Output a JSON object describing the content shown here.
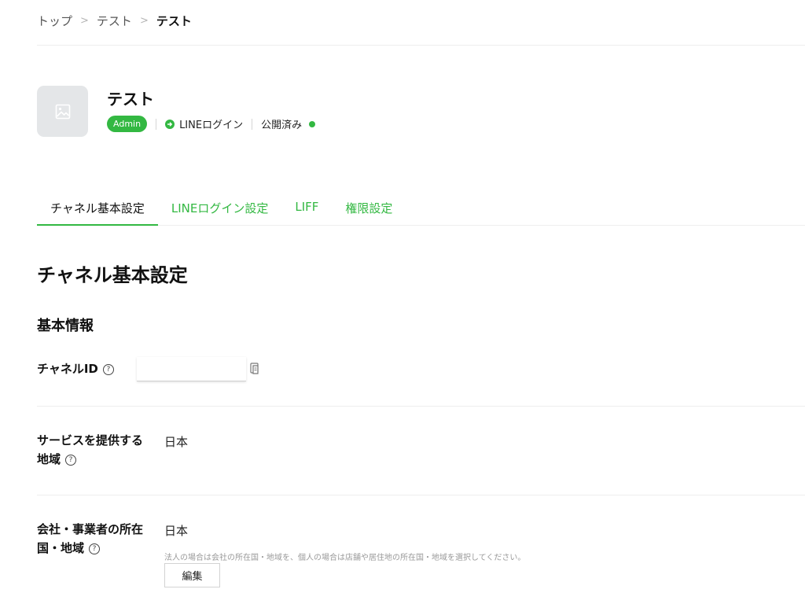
{
  "breadcrumb": {
    "items": [
      "トップ",
      "テスト",
      "テスト"
    ],
    "separator": ">"
  },
  "channel": {
    "title": "テスト",
    "role_badge": "Admin",
    "type_label": "LINEログイン",
    "status": "公開済み",
    "status_color": "#33b842",
    "thumbnail_icon": "image-icon"
  },
  "tabs": [
    {
      "label": "チャネル基本設定",
      "active": true
    },
    {
      "label": "LINEログイン設定",
      "active": false
    },
    {
      "label": "LIFF",
      "active": false
    },
    {
      "label": "権限設定",
      "active": false
    }
  ],
  "main": {
    "page_heading": "チャネル基本設定",
    "section_heading": "基本情報",
    "channel_id": {
      "label": "チャネルID",
      "help": "?",
      "value": "",
      "copy_icon": "copy-icon"
    },
    "service_region": {
      "label_line1": "サービスを提供する",
      "label_line2": "地域",
      "help": "?",
      "value": "日本"
    },
    "company_region": {
      "label_line1": "会社・事業者の所在",
      "label_line2": "国・地域",
      "help": "?",
      "value": "日本",
      "note": "法人の場合は会社の所在国・地域を、個人の場合は店舗や居住地の所在国・地域を選択してください。",
      "edit_label": "編集"
    }
  },
  "colors": {
    "accent": "#33b842",
    "text": "#111111",
    "divider": "#eeeeee"
  }
}
